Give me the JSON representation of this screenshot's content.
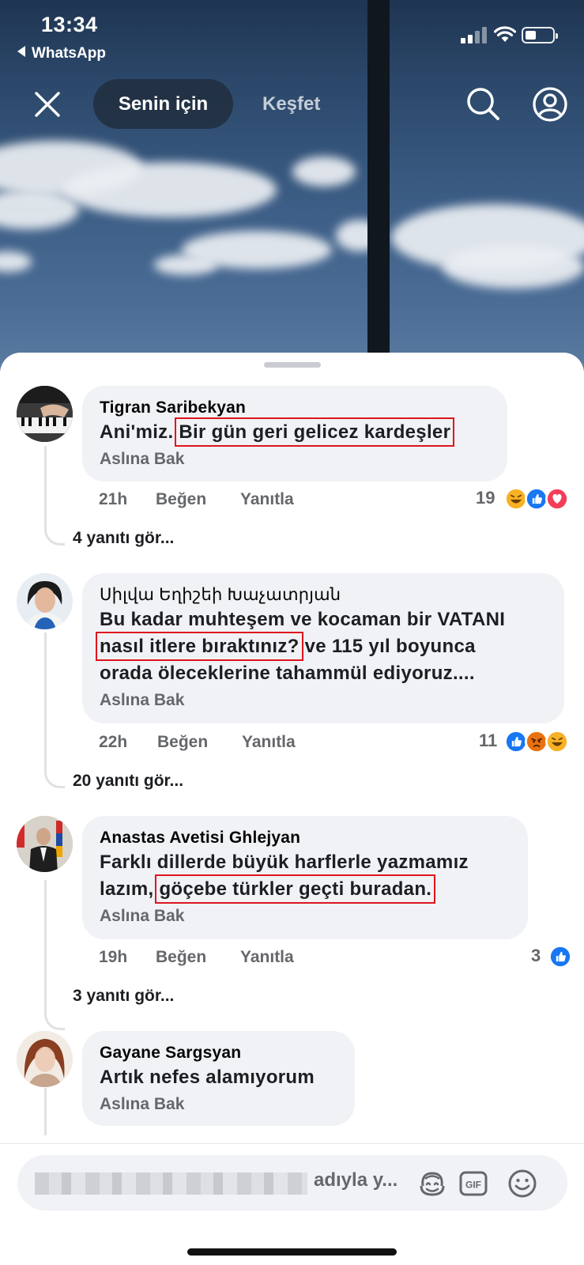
{
  "status_bar": {
    "time": "13:34",
    "back_app": "WhatsApp"
  },
  "top_nav": {
    "tab_active": "Senin için",
    "tab_other": "Keşfet"
  },
  "comments": [
    {
      "author": "Tigran Saribekyan",
      "text_plain": "Ani'miz. ",
      "text_highlight": "Bir gün geri gelicez kardeşler",
      "see_original": "Aslına Bak",
      "time": "21h",
      "like": "Beğen",
      "reply": "Yanıtla",
      "reaction_count": "19",
      "reactions": [
        "haha",
        "like",
        "love"
      ],
      "view_replies": "4 yanıtı gör..."
    },
    {
      "author": "Սիլվա Եղիշեի Խաչատրյան",
      "text_line1": "Bu kadar muhteşem ve kocaman bir VATANI",
      "text_highlight": "nasıl itlere bıraktınız?",
      "text_line2_rest": " ve 115 yıl boyunca",
      "text_line3": "orada öleceklerine tahammül ediyoruz....",
      "see_original": "Aslına Bak",
      "time": "22h",
      "like": "Beğen",
      "reply": "Yanıtla",
      "reaction_count": "11",
      "reactions": [
        "like",
        "angry",
        "haha"
      ],
      "view_replies": "20 yanıtı gör..."
    },
    {
      "author": "Anastas Avetisi Ghlejyan",
      "text_line1": "Farklı dillerde büyük harflerle yazmamız",
      "text_line2_plain": "lazım, ",
      "text_highlight": "göçebe türkler geçti buradan.",
      "see_original": "Aslına Bak",
      "time": "19h",
      "like": "Beğen",
      "reply": "Yanıtla",
      "reaction_count": "3",
      "reactions": [
        "like"
      ],
      "view_replies": "3 yanıtı gör..."
    },
    {
      "author": "Gayane Sargsyan",
      "text_plain": "Artık nefes alamıyorum",
      "see_original": "Aslına Bak"
    }
  ],
  "composer": {
    "hint_visible": "adıyla y...",
    "icons": [
      "avatar-sticker-icon",
      "gif-icon",
      "emoji-icon"
    ]
  },
  "colors": {
    "highlight_box": "#e0141e",
    "like_blue": "#1877f2",
    "love_red": "#f33e58",
    "reaction_yellow": "#f7b125",
    "angry_orange": "#e9710f",
    "bubble_bg": "#f0f2f5",
    "secondary_text": "#65676b"
  }
}
